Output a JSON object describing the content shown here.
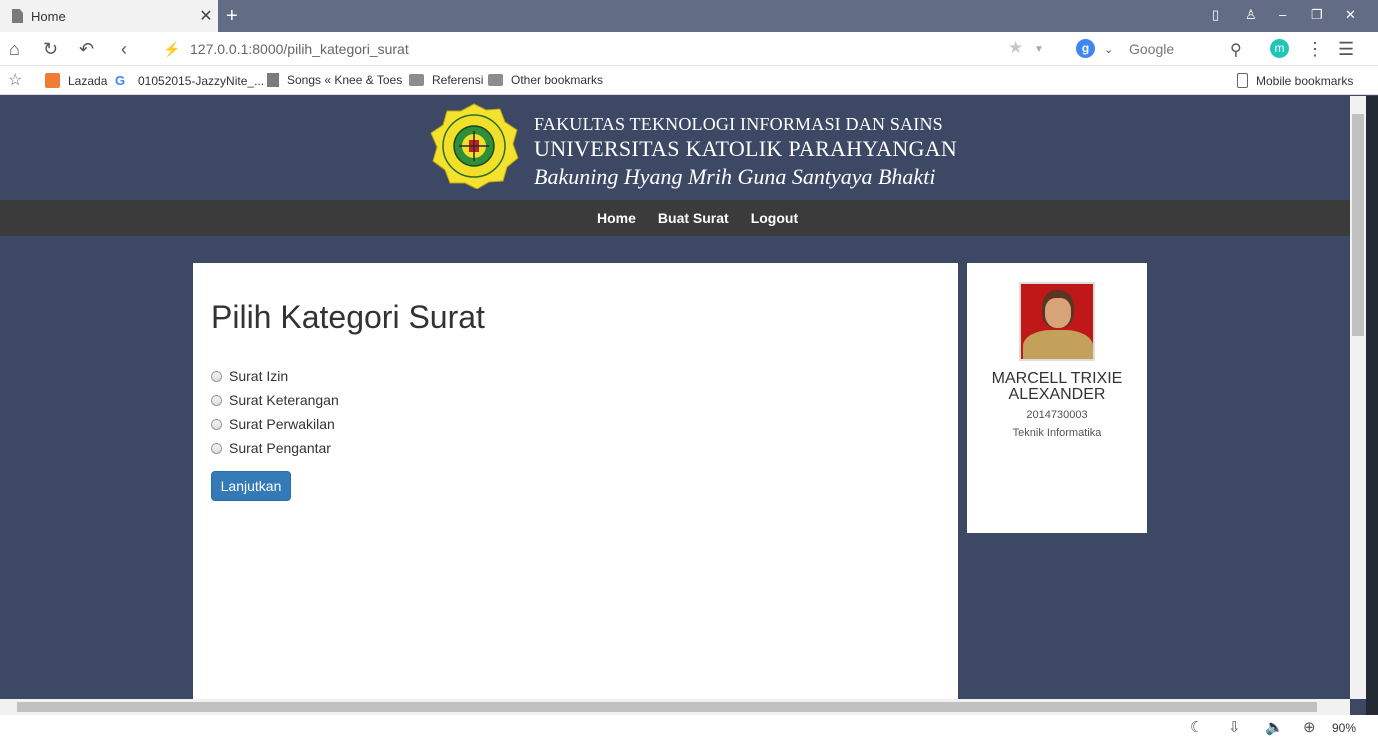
{
  "browser": {
    "tab_title": "Home",
    "url": "127.0.0.1:8000/pilih_kategori_surat",
    "search_engine_letter": "g",
    "search_label": "Google",
    "profile_initial": "m",
    "zoom": "90%",
    "bookmarks": [
      "Lazada",
      "01052015-JazzyNite_...",
      "Songs « Knee & Toes",
      "Referensi",
      "Other bookmarks"
    ],
    "mobile_bookmarks": "Mobile bookmarks"
  },
  "header": {
    "line1": "FAKULTAS TEKNOLOGI INFORMASI DAN SAINS",
    "line2": "UNIVERSITAS KATOLIK PARAHYANGAN",
    "motto": "Bakuning Hyang Mrih Guna Santyaya Bhakti",
    "logo_text_top": "UNIVERSITAS KATOLIK",
    "logo_text_bottom": "PARAHYANGAN"
  },
  "nav": {
    "home": "Home",
    "buat_surat": "Buat Surat",
    "logout": "Logout"
  },
  "main": {
    "title": "Pilih Kategori Surat",
    "options": [
      "Surat Izin",
      "Surat Keterangan",
      "Surat Perwakilan",
      "Surat Pengantar"
    ],
    "submit": "Lanjutkan"
  },
  "profile": {
    "name": "MARCELL TRIXIE ALEXANDER",
    "nim": "2014730003",
    "major": "Teknik Informatika"
  }
}
